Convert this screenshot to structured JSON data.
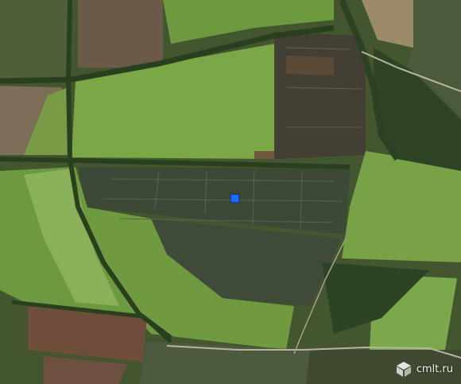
{
  "map": {
    "type": "satellite",
    "marker": {
      "shape": "square",
      "color": "#1e6bff"
    },
    "watermark": {
      "text": "cmlt.ru",
      "icon": "cube-logo-icon"
    },
    "colors": {
      "bright_field": "#6f9a3e",
      "light_field": "#8cb255",
      "dark_plot": "#3f4a35",
      "plowed_field": "#6e5840",
      "tree_line": "#2a3f1e"
    }
  }
}
